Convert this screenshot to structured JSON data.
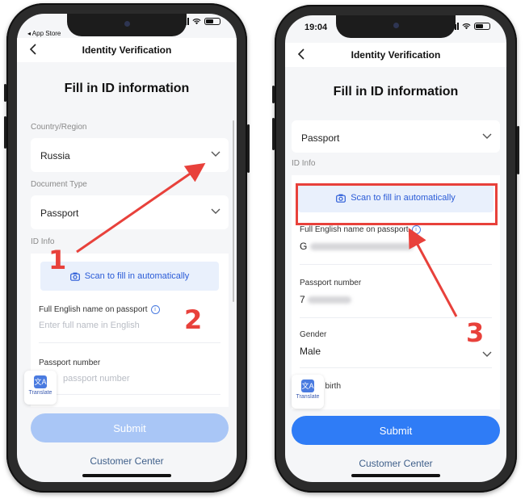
{
  "left_phone": {
    "status": {
      "back_app": "◂ App Store"
    },
    "nav_title": "Identity Verification",
    "heading": "Fill in ID information",
    "country_label": "Country/Region",
    "country_value": "Russia",
    "doc_type_label": "Document Type",
    "doc_type_value": "Passport",
    "id_info_label": "ID Info",
    "scan_label": "Scan to fill in automatically",
    "name_label": "Full English name on passport",
    "name_placeholder": "Enter full name in English",
    "passport_label": "Passport number",
    "passport_placeholder": "passport number",
    "translate_label": "Translate",
    "submit_label": "Submit",
    "customer_center": "Customer Center"
  },
  "right_phone": {
    "status": {
      "time": "19:04"
    },
    "nav_title": "Identity Verification",
    "heading": "Fill in ID information",
    "doc_type_value": "Passport",
    "id_info_label": "ID Info",
    "scan_label": "Scan to fill in automatically",
    "name_label": "Full English name on passport",
    "name_value_visible": "G",
    "passport_label": "Passport number",
    "passport_value_visible": "7",
    "gender_label": "Gender",
    "gender_value": "Male",
    "dob_label_partial": "f birth",
    "translate_label": "Translate",
    "submit_label": "Submit",
    "customer_center": "Customer Center"
  },
  "annotations": {
    "step1": "1",
    "step2": "2",
    "step3": "3"
  },
  "colors": {
    "annotation_red": "#e8413b",
    "submit_disabled": "#a9c6f6",
    "submit_enabled": "#2f7cf6",
    "scan_text": "#2a5bd7",
    "scan_bg": "#e9f0fc",
    "link": "#3f5f8a"
  },
  "icons": [
    "back-chevron-icon",
    "chevron-down-icon",
    "camera-icon",
    "info-icon",
    "translate-icon",
    "signal-icon",
    "wifi-icon",
    "battery-icon"
  ]
}
